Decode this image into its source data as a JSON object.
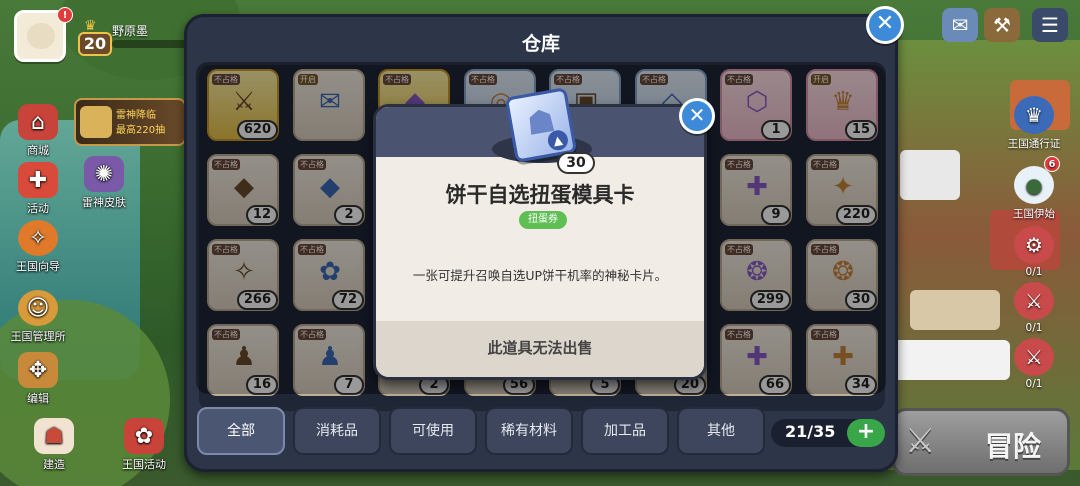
{
  "hud": {
    "player_name": "野原墨",
    "level": "20",
    "avatar_badge": "!",
    "promo_text": "雷神降临",
    "promo_sub": "最高220抽",
    "left_buttons": [
      {
        "label": "商城",
        "icon": "shop-icon"
      },
      {
        "label": "雷神皮肤",
        "icon": "skin-icon"
      },
      {
        "label": "活动",
        "icon": "gift-icon"
      },
      {
        "label": "王国向导",
        "icon": "compass-icon"
      },
      {
        "label": "王国管理所",
        "icon": "management-icon"
      },
      {
        "label": "编辑",
        "icon": "edit-icon"
      },
      {
        "label": "建造",
        "icon": "build-icon"
      },
      {
        "label": "王国活动",
        "icon": "kingdom-event-icon"
      }
    ],
    "right_buttons": [
      {
        "label": "王国通行证",
        "icon": "pass-icon"
      },
      {
        "label": "王国伊始",
        "icon": "kingdom-start-icon"
      },
      {
        "label": "0/1",
        "icon": "production-icon"
      },
      {
        "label": "0/1",
        "icon": "sword-icon"
      },
      {
        "label": "0/1",
        "icon": "sword-icon"
      }
    ],
    "adventure_label": "冒险",
    "right_badge_count": "6"
  },
  "panel": {
    "title": "仓库",
    "tabs": [
      "全部",
      "消耗品",
      "可使用",
      "稀有材料",
      "加工品",
      "其他"
    ],
    "active_tab": "全部",
    "capacity": "21/35",
    "items": [
      {
        "tag": "不占格",
        "count": "620",
        "style": "gold",
        "icon": "sword-fragment-icon",
        "glyph": "⚔"
      },
      {
        "tag": "开启",
        "count": "",
        "style": "",
        "icon": "scroll-icon",
        "glyph": "✉"
      },
      {
        "tag": "不占格",
        "count": "",
        "style": "gold",
        "icon": "bag-icon",
        "glyph": "◆"
      },
      {
        "tag": "不占格",
        "count": "",
        "style": "blue",
        "icon": "ring-icon",
        "glyph": "◎"
      },
      {
        "tag": "不占格",
        "count": "",
        "style": "blue",
        "icon": "card-icon",
        "glyph": "▣"
      },
      {
        "tag": "不占格",
        "count": "",
        "style": "blue",
        "icon": "crystal-icon",
        "glyph": "◇"
      },
      {
        "tag": "不占格",
        "count": "1",
        "style": "pink",
        "icon": "crest-icon",
        "glyph": "⬡"
      },
      {
        "tag": "开启",
        "count": "15",
        "style": "pink",
        "icon": "lamp-icon",
        "glyph": "♛"
      },
      {
        "tag": "不占格",
        "count": "12",
        "style": "",
        "icon": "amber-crystal-icon",
        "glyph": "◆"
      },
      {
        "tag": "不占格",
        "count": "2",
        "style": "",
        "icon": "blue-crystal-icon",
        "glyph": "◆"
      },
      {
        "tag": "不占格",
        "count": "9",
        "style": "",
        "icon": "cross-ornament-icon",
        "glyph": "✚"
      },
      {
        "tag": "不占格",
        "count": "220",
        "style": "",
        "icon": "star-icon",
        "glyph": "✦"
      },
      {
        "tag": "不占格",
        "count": "266",
        "style": "",
        "icon": "amber-star-icon",
        "glyph": "✧"
      },
      {
        "tag": "不占格",
        "count": "72",
        "style": "",
        "icon": "cloud-gem-icon",
        "glyph": "✿"
      },
      {
        "tag": "不占格",
        "count": "299",
        "style": "",
        "icon": "candy-jar-icon",
        "glyph": "❂"
      },
      {
        "tag": "不占格",
        "count": "30",
        "style": "",
        "icon": "gem-jar-icon",
        "glyph": "❂"
      },
      {
        "tag": "不占格",
        "count": "16",
        "style": "",
        "icon": "blue-potion-icon",
        "glyph": "♟"
      },
      {
        "tag": "不占格",
        "count": "7",
        "style": "",
        "icon": "blue-flask-icon",
        "glyph": "♟"
      },
      {
        "tag": "",
        "count": "2",
        "style": "",
        "icon": "item-icon",
        "glyph": ""
      },
      {
        "tag": "",
        "count": "56",
        "style": "",
        "icon": "item-icon",
        "glyph": ""
      },
      {
        "tag": "",
        "count": "5",
        "style": "",
        "icon": "item-icon",
        "glyph": ""
      },
      {
        "tag": "",
        "count": "20",
        "style": "",
        "icon": "item-icon",
        "glyph": ""
      },
      {
        "tag": "不占格",
        "count": "66",
        "style": "",
        "icon": "pouch-icon",
        "glyph": "✚"
      },
      {
        "tag": "不占格",
        "count": "34",
        "style": "",
        "icon": "gold-pouch-icon",
        "glyph": "✚"
      }
    ]
  },
  "popup": {
    "item_name": "饼干自选扭蛋模具卡",
    "category_badge": "扭蛋券",
    "quantity": "30",
    "description": "一张可提升召唤自选UP饼干机率的神秘卡片。",
    "footer_note": "此道具无法出售",
    "icon": "cookie-card-icon"
  },
  "colors": {
    "panel_bg": "#2d3549",
    "close_button": "#3c8ad8",
    "plus_button": "#3aa64a",
    "badge_green": "#5fbf55"
  }
}
